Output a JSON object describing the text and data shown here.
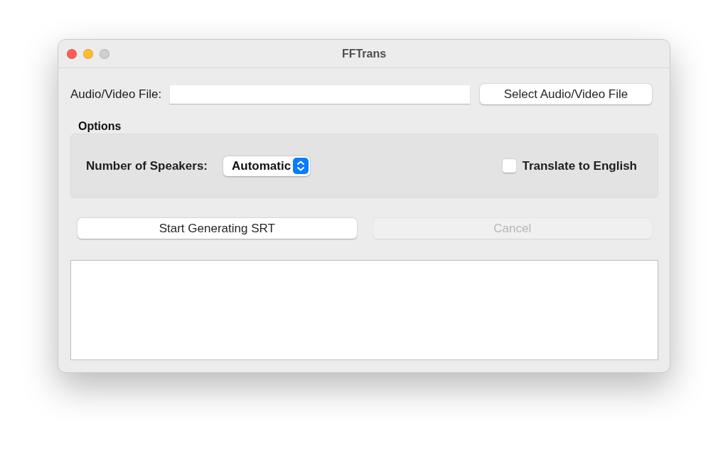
{
  "window": {
    "title": "FFTrans"
  },
  "file_row": {
    "label": "Audio/Video File:",
    "button": "Select Audio/Video File"
  },
  "options": {
    "title": "Options",
    "speakers_label": "Number of Speakers:",
    "speakers_value": "Automatic",
    "translate": {
      "label": "Translate to English",
      "checked": false
    }
  },
  "actions": [
    {
      "label": "Start Generating SRT",
      "disabled": false
    },
    {
      "label": "Cancel",
      "disabled": true
    }
  ]
}
